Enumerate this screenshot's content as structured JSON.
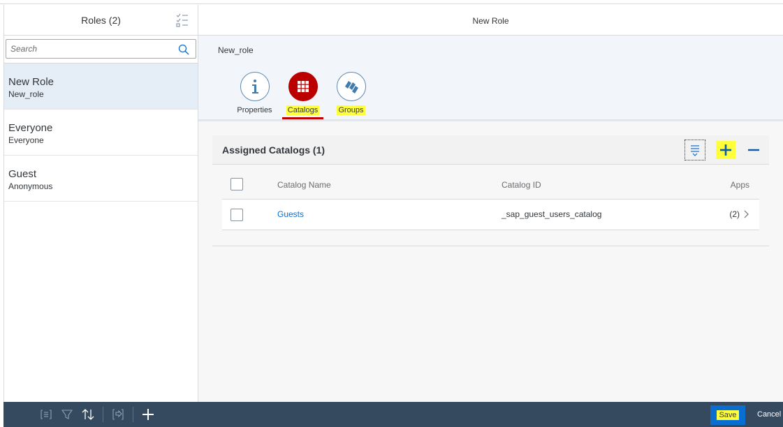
{
  "master": {
    "title": "Roles (2)",
    "search_placeholder": "Search",
    "items": [
      {
        "title": "New Role",
        "subtitle": "New_role"
      },
      {
        "title": "Everyone",
        "subtitle": "Everyone"
      },
      {
        "title": "Guest",
        "subtitle": "Anonymous"
      }
    ]
  },
  "detail": {
    "header_title": "New Role",
    "object_name": "New_role",
    "tabs": [
      {
        "label": "Properties",
        "icon": "info-icon"
      },
      {
        "label": "Catalogs",
        "icon": "grid-icon"
      },
      {
        "label": "Groups",
        "icon": "groups-icon"
      }
    ],
    "selected_tab": "Catalogs",
    "section": {
      "title": "Assigned Catalogs (1)",
      "columns": {
        "name": "Catalog Name",
        "id": "Catalog ID",
        "apps": "Apps"
      },
      "rows": [
        {
          "name": "Guests",
          "id": "_sap_guest_users_catalog",
          "apps": "(2)"
        }
      ]
    }
  },
  "footer": {
    "save_label": "Save",
    "cancel_label": "Cancel"
  },
  "colors": {
    "accent": "#0a6ed1",
    "active_tab": "#bb0000",
    "footer_bg": "#354a5f",
    "highlight": "#ffff3c"
  }
}
